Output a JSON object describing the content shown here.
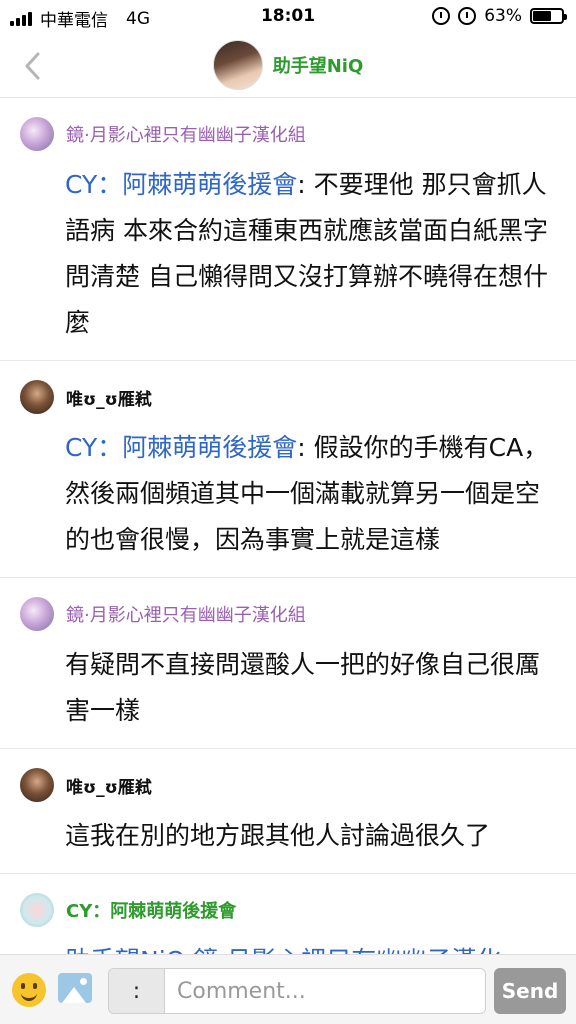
{
  "status_bar": {
    "carrier": "中華電信",
    "network": "4G",
    "time": "18:01",
    "battery_percent": "63%",
    "battery_level": 0.63
  },
  "header": {
    "title": "助手望NiQ"
  },
  "messages": [
    {
      "author": "鏡·月影心裡只有幽幽子漢化組",
      "mention": "CY：阿棘萌萌後援會",
      "text": ": 不要理他 那只會抓人語病 本來合約這種東西就應該當面白紙黑字問清楚 自己懶得問又沒打算辦不曉得在想什麼"
    },
    {
      "author": "唯ʊ_ʊ雁弒",
      "mention": "CY：阿棘萌萌後援會",
      "text": ": 假設你的手機有CA，然後兩個頻道其中一個滿載就算另一個是空的也會很慢，因為事實上就是這樣"
    },
    {
      "author": "鏡·月影心裡只有幽幽子漢化組",
      "mention": "",
      "text": "有疑問不直接問還酸人一把的好像自己很厲害一樣"
    },
    {
      "author": "唯ʊ_ʊ雁弒",
      "mention": "",
      "text": "這我在別的地方跟其他人討論過很久了"
    },
    {
      "author": "CY：阿棘萌萌後援會",
      "mention": "助手望NiQ 鏡·月影心裡只有幽幽子漢化",
      "text": ""
    }
  ],
  "comment_bar": {
    "colon_label": ":",
    "placeholder": "Comment...",
    "send_label": "Send"
  },
  "colors": {
    "mention": "#2f66c9",
    "green_name": "#2e9b2e",
    "purple_name": "#9b5fb3",
    "send_button": "#999999"
  }
}
